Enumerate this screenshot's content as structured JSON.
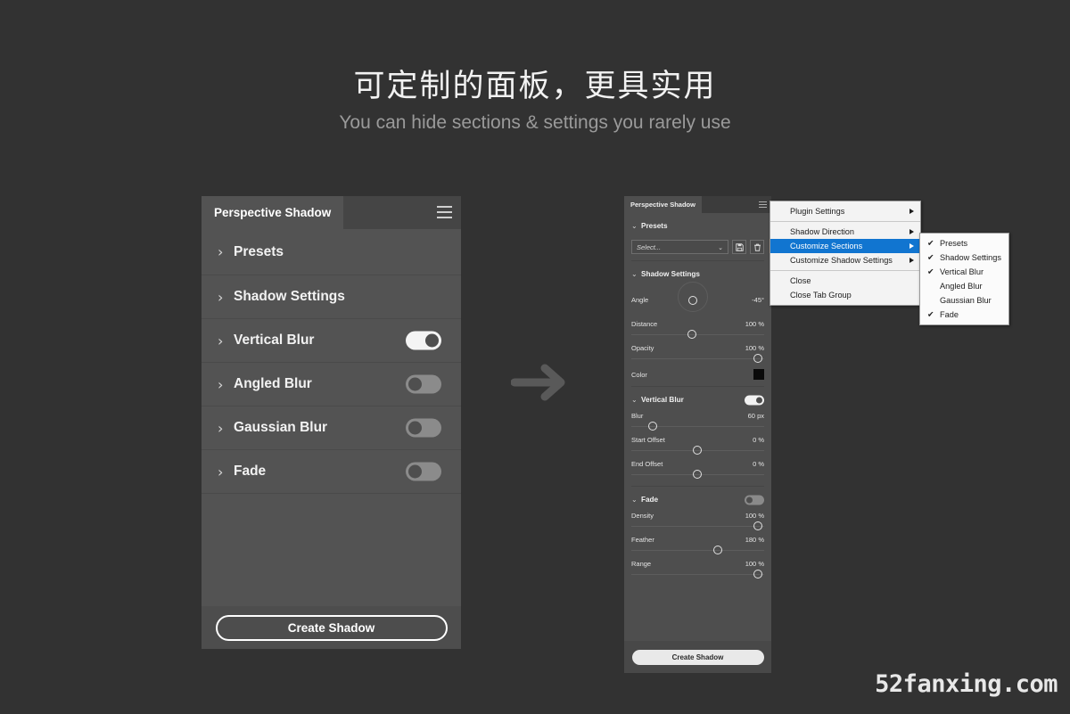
{
  "headline": "可定制的面板，更具实用",
  "subhead": "You can hide sections & settings you rarely use",
  "watermark": "52fanxing.com",
  "left_panel": {
    "tab_title": "Perspective Shadow",
    "menu_icon": "hamburger-menu-icon",
    "sections": [
      {
        "label": "Presets",
        "expanded": false,
        "toggle": null
      },
      {
        "label": "Shadow Settings",
        "expanded": false,
        "toggle": null
      },
      {
        "label": "Vertical Blur",
        "expanded": false,
        "toggle": "on"
      },
      {
        "label": "Angled Blur",
        "expanded": false,
        "toggle": "off"
      },
      {
        "label": "Gaussian Blur",
        "expanded": false,
        "toggle": "off"
      },
      {
        "label": "Fade",
        "expanded": false,
        "toggle": "off"
      }
    ],
    "chevron_collapsed": "›",
    "create_button": "Create Shadow"
  },
  "right_panel": {
    "tab_title": "Perspective Shadow",
    "menu_icon": "hamburger-menu-icon",
    "chevron_expanded": "⌄",
    "presets": {
      "label": "Presets",
      "select_value": "Select...",
      "caret_icon": "chevron-down-icon",
      "save_icon": "save-preset-icon",
      "delete_icon": "delete-preset-icon"
    },
    "shadow_settings": {
      "label": "Shadow Settings",
      "controls": [
        {
          "name": "Angle",
          "value": "-45°",
          "knob_pct": 42
        },
        {
          "name": "Distance",
          "value": "100 %",
          "knob_pct": 42
        },
        {
          "name": "Opacity",
          "value": "100 %",
          "knob_pct": 92
        }
      ],
      "color_label": "Color",
      "color_value": "#0a0a0a"
    },
    "vertical_blur": {
      "label": "Vertical Blur",
      "toggle": "on",
      "controls": [
        {
          "name": "Blur",
          "value": "60 px",
          "knob_pct": 13
        },
        {
          "name": "Start Offset",
          "value": "0 %",
          "knob_pct": 46
        },
        {
          "name": "End Offset",
          "value": "0 %",
          "knob_pct": 46
        }
      ]
    },
    "fade": {
      "label": "Fade",
      "toggle": "off",
      "controls": [
        {
          "name": "Density",
          "value": "100 %",
          "knob_pct": 92
        },
        {
          "name": "Feather",
          "value": "180 %",
          "knob_pct": 62
        },
        {
          "name": "Range",
          "value": "100 %",
          "knob_pct": 92
        }
      ]
    },
    "create_button": "Create Shadow"
  },
  "context_menu": {
    "items": [
      {
        "label": "Plugin Settings",
        "submenu": true,
        "selected": false,
        "separator_after": true
      },
      {
        "label": "Shadow Direction",
        "submenu": true,
        "selected": false,
        "separator_after": false
      },
      {
        "label": "Customize Sections",
        "submenu": true,
        "selected": true,
        "separator_after": false
      },
      {
        "label": "Customize Shadow Settings",
        "submenu": true,
        "selected": false,
        "separator_after": true
      },
      {
        "label": "Close",
        "submenu": false,
        "selected": false,
        "separator_after": false
      },
      {
        "label": "Close Tab Group",
        "submenu": false,
        "selected": false,
        "separator_after": false
      }
    ]
  },
  "submenu": {
    "check_glyph": "✔",
    "items": [
      {
        "label": "Presets",
        "checked": true
      },
      {
        "label": "Shadow Settings",
        "checked": true
      },
      {
        "label": "Vertical Blur",
        "checked": true
      },
      {
        "label": "Angled Blur",
        "checked": false
      },
      {
        "label": "Gaussian Blur",
        "checked": false
      },
      {
        "label": "Fade",
        "checked": true
      }
    ]
  },
  "arrow_icon": "right-arrow-icon",
  "colors": {
    "background": "#323232",
    "panel_left": "#535353",
    "panel_right": "#4e4e4e",
    "menu_highlight": "#1175d0"
  }
}
